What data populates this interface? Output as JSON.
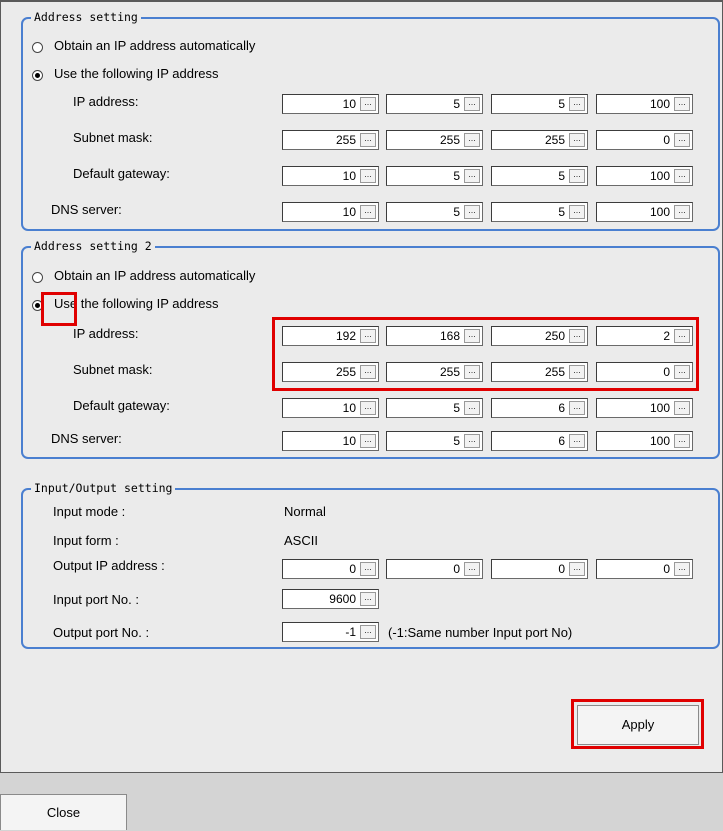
{
  "section1": {
    "title": "Address setting",
    "radio_auto": "Obtain an IP address automatically",
    "radio_manual": "Use the following IP address",
    "ip_label": "IP address:",
    "subnet_label": "Subnet mask:",
    "gateway_label": "Default gateway:",
    "dns_label": "DNS server:",
    "ip": [
      "10",
      "5",
      "5",
      "100"
    ],
    "subnet": [
      "255",
      "255",
      "255",
      "0"
    ],
    "gateway": [
      "10",
      "5",
      "5",
      "100"
    ],
    "dns": [
      "10",
      "5",
      "5",
      "100"
    ]
  },
  "section2": {
    "title": "Address setting 2",
    "radio_auto": "Obtain an IP address automatically",
    "radio_manual": "Use the following IP address",
    "ip_label": "IP address:",
    "subnet_label": "Subnet mask:",
    "gateway_label": "Default gateway:",
    "dns_label": "DNS server:",
    "ip": [
      "192",
      "168",
      "250",
      "2"
    ],
    "subnet": [
      "255",
      "255",
      "255",
      "0"
    ],
    "gateway": [
      "10",
      "5",
      "6",
      "100"
    ],
    "dns": [
      "10",
      "5",
      "6",
      "100"
    ]
  },
  "io": {
    "title": "Input/Output setting",
    "input_mode_label": "Input mode :",
    "input_mode_value": "Normal",
    "input_form_label": "Input form :",
    "input_form_value": "ASCII",
    "output_ip_label": "Output IP address :",
    "output_ip": [
      "0",
      "0",
      "0",
      "0"
    ],
    "input_port_label": "Input port No. :",
    "input_port": "9600",
    "output_port_label": "Output port No. :",
    "output_port": "-1",
    "output_port_note": "(-1:Same number Input port No)"
  },
  "spin_glyph": "...",
  "buttons": {
    "apply": "Apply",
    "close": "Close"
  },
  "colors": {
    "group_border": "#4a7fd0",
    "highlight": "#e00000"
  }
}
